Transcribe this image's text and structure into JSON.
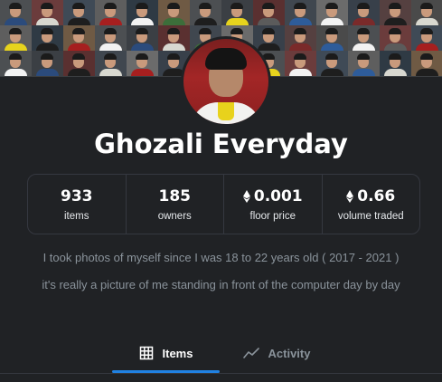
{
  "banner": {
    "tile_shirts": [
      "#2b4b7c",
      "#d8d8d0",
      "#1e1e1e",
      "#a61f1f",
      "#f2f2f2",
      "#3c6e3a",
      "#1e1e1e",
      "#e7d31d",
      "#5b5b5b",
      "#2e5c9a",
      "#f2f2f2",
      "#7a2a2a",
      "#1e1e1e",
      "#d8d8d0",
      "#e7d31d",
      "#1e1e1e",
      "#a61f1f",
      "#f2f2f2",
      "#2b4b7c",
      "#d8d8d0",
      "#3c6e3a",
      "#f2f2f2",
      "#1e1e1e",
      "#7a2a2a",
      "#2e5c9a",
      "#f2f2f2",
      "#5b5b5b",
      "#a61f1f",
      "#f2f2f2",
      "#2b4b7c",
      "#1e1e1e",
      "#d8d8d0",
      "#a61f1f",
      "#1e1e1e",
      "#f2f2f2",
      "#3c6e3a",
      "#e7d31d",
      "#f2f2f2",
      "#1e1e1e",
      "#2e5c9a",
      "#d8d8d0",
      "#1e1e1e"
    ],
    "tile_backgrounds": [
      "#4c4f52",
      "#6b3c3c",
      "#3f4a56",
      "#5e5e5e",
      "#2f3a44",
      "#6f5a44",
      "#4c4f52",
      "#3b3f44",
      "#5a3030",
      "#40474f",
      "#6b6b6b",
      "#38404a",
      "#554040",
      "#4a4a4a"
    ]
  },
  "collection": {
    "name": "Ghozali Everyday",
    "description_line1": "I took photos of myself since I was 18 to 22 years old ( 2017 - 2021 )",
    "description_line2": "it's really a picture of me standing in front of the computer day by day"
  },
  "stats": {
    "items_value": "933",
    "items_label": "items",
    "owners_value": "185",
    "owners_label": "owners",
    "floor_value": "0.001",
    "floor_label": "floor price",
    "volume_value": "0.66",
    "volume_label": "volume traded",
    "currency_icon": "ethereum-icon"
  },
  "tabs": [
    {
      "label": "Items",
      "icon": "grid-icon",
      "active": true
    },
    {
      "label": "Activity",
      "icon": "trend-line-icon",
      "active": false
    }
  ],
  "colors": {
    "background": "#202225",
    "accent": "#2081e2",
    "muted_text": "#8a939b",
    "border": "#353840"
  }
}
